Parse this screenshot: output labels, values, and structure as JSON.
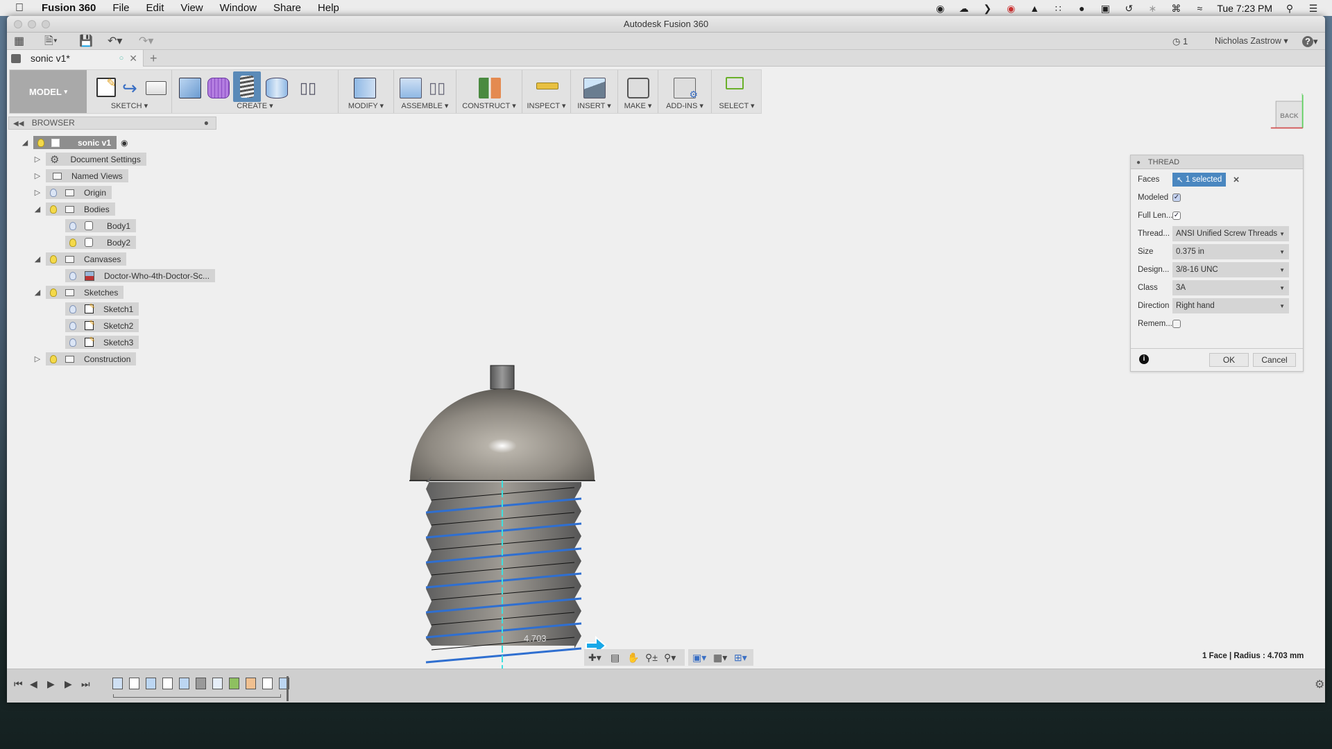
{
  "menubar": {
    "apple_icon": "apple-logo",
    "app_name": "Fusion 360",
    "items": [
      "File",
      "Edit",
      "View",
      "Window",
      "Share",
      "Help"
    ],
    "status_icons": [
      "record-icon",
      "cloud-upload-icon",
      "chevron-right-icon",
      "creative-cloud-icon",
      "privacy-icon",
      "grid-dots-icon",
      "chat-bubble-icon",
      "display-icon",
      "time-machine-icon",
      "bluetooth-icon",
      "keyboard-icon",
      "wifi-icon"
    ],
    "clock": "Tue 7:23 PM",
    "search_icon": "spotlight-icon",
    "list_icon": "notification-center-icon"
  },
  "window": {
    "title": "Autodesk Fusion 360"
  },
  "quick_access": {
    "job_count": "1",
    "user_name": "Nicholas Zastrow",
    "help_label": "?"
  },
  "tabs": [
    {
      "label": "sonic v1*",
      "active": true
    }
  ],
  "new_tab_label": "+",
  "ribbon": {
    "workspace": "MODEL",
    "groups": [
      {
        "label": "SKETCH",
        "tools": [
          "create-sketch",
          "spline",
          "rectangle"
        ]
      },
      {
        "label": "CREATE",
        "tools": [
          "box",
          "form",
          "coil",
          "cylinder",
          "mirror"
        ],
        "active_tool": "coil"
      },
      {
        "label": "MODIFY",
        "tools": [
          "press-pull"
        ]
      },
      {
        "label": "ASSEMBLE",
        "tools": [
          "new-component",
          "joint"
        ]
      },
      {
        "label": "CONSTRUCT",
        "tools": [
          "offset-plane"
        ]
      },
      {
        "label": "INSPECT",
        "tools": [
          "measure"
        ]
      },
      {
        "label": "INSERT",
        "tools": [
          "insert-image"
        ]
      },
      {
        "label": "MAKE",
        "tools": [
          "3d-print"
        ]
      },
      {
        "label": "ADD-INS",
        "tools": [
          "scripts"
        ]
      },
      {
        "label": "SELECT",
        "tools": [
          "window-select"
        ]
      }
    ]
  },
  "browser": {
    "title": "BROWSER",
    "root": "sonic v1",
    "items": [
      {
        "label": "Document Settings",
        "level": 1,
        "expanded": false,
        "icon": "gear"
      },
      {
        "label": "Named Views",
        "level": 1,
        "expanded": false,
        "icon": "folder"
      },
      {
        "label": "Origin",
        "level": 1,
        "expanded": false,
        "icon": "folder",
        "visible": false
      },
      {
        "label": "Bodies",
        "level": 1,
        "expanded": true,
        "icon": "folder",
        "visible": true
      },
      {
        "label": "Body1",
        "level": 2,
        "icon": "body",
        "visible": false
      },
      {
        "label": "Body2",
        "level": 2,
        "icon": "body",
        "visible": true
      },
      {
        "label": "Canvases",
        "level": 1,
        "expanded": true,
        "icon": "folder",
        "visible": true
      },
      {
        "label": "Doctor-Who-4th-Doctor-Sc...",
        "level": 2,
        "icon": "canvas",
        "visible": false
      },
      {
        "label": "Sketches",
        "level": 1,
        "expanded": true,
        "icon": "folder",
        "visible": true
      },
      {
        "label": "Sketch1",
        "level": 2,
        "icon": "sketch",
        "visible": false
      },
      {
        "label": "Sketch2",
        "level": 2,
        "icon": "sketch",
        "visible": false
      },
      {
        "label": "Sketch3",
        "level": 2,
        "icon": "sketch",
        "visible": false
      },
      {
        "label": "Construction",
        "level": 1,
        "expanded": false,
        "icon": "folder",
        "visible": true
      }
    ]
  },
  "viewcube": {
    "face": "BACK",
    "x_axis": "X",
    "y_axis": "Y"
  },
  "viewport": {
    "dimension_label": "4.703",
    "status": "1 Face | Radius : 4.703 mm"
  },
  "thread_dialog": {
    "title": "THREAD",
    "fields": {
      "faces": {
        "label": "Faces",
        "value": "1 selected"
      },
      "modeled": {
        "label": "Modeled",
        "checked": true
      },
      "full_length": {
        "label": "Full Len...",
        "checked": true
      },
      "thread_type": {
        "label": "Thread...",
        "value": "ANSI Unified Screw Threads"
      },
      "size": {
        "label": "Size",
        "value": "0.375 in"
      },
      "designation": {
        "label": "Design...",
        "value": "3/8-16 UNC"
      },
      "class": {
        "label": "Class",
        "value": "3A"
      },
      "direction": {
        "label": "Direction",
        "value": "Right hand"
      },
      "remember": {
        "label": "Remem...",
        "checked": false
      }
    },
    "ok_label": "OK",
    "cancel_label": "Cancel"
  },
  "timeline": {
    "features": [
      "canvas",
      "sketch",
      "revolve",
      "sketch",
      "extrude",
      "coil",
      "shell",
      "joint",
      "split",
      "sketch",
      "revolve"
    ]
  },
  "colors": {
    "accent_selected": "#4a87c0",
    "active_tool": "#5a8ab8",
    "thread_helix": "#2f6fd0",
    "axis_cyan": "#3ee0e0",
    "viewcube_x": "#d04040",
    "viewcube_y": "#50d050"
  }
}
